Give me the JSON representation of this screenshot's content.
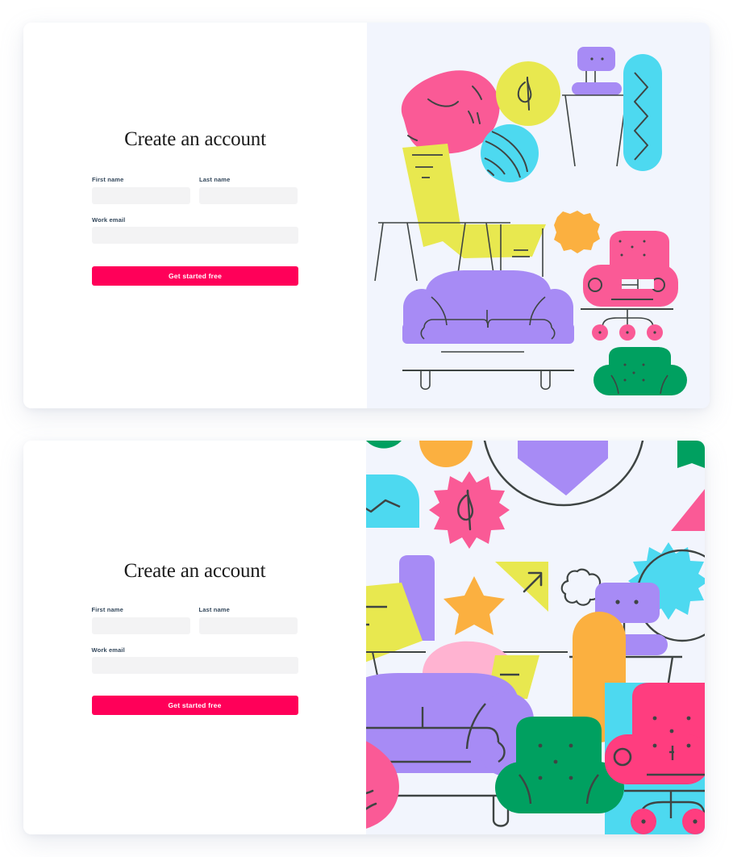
{
  "panels": [
    {
      "heading": "Create an account",
      "fields": {
        "first_name": {
          "label": "First name",
          "value": "",
          "placeholder": ""
        },
        "last_name": {
          "label": "Last name",
          "value": "",
          "placeholder": ""
        },
        "work_email": {
          "label": "Work email",
          "value": "",
          "placeholder": ""
        }
      },
      "cta_label": "Get started free"
    },
    {
      "heading": "Create an account",
      "fields": {
        "first_name": {
          "label": "First name",
          "value": "",
          "placeholder": ""
        },
        "last_name": {
          "label": "Last name",
          "value": "",
          "placeholder": ""
        },
        "work_email": {
          "label": "Work email",
          "value": "",
          "placeholder": ""
        }
      },
      "cta_label": "Get started free"
    }
  ],
  "colors": {
    "page_background": "#ffffff",
    "card_background": "#ffffff",
    "art_background": "#F2F5FD",
    "input_background": "#F3F3F4",
    "label_text": "#33475b",
    "heading_text": "#1b1b1b",
    "cta_background": "#FF0059",
    "cta_text": "#ffffff",
    "illustration_pink": "#FA5A96",
    "illustration_magenta": "#FF3D7F",
    "illustration_yellow": "#E8E84F",
    "illustration_cyan": "#4DD9F0",
    "illustration_purple": "#A78BF5",
    "illustration_orange": "#FBB040",
    "illustration_green": "#00A060",
    "illustration_lightpink": "#FFB3D1",
    "illustration_stroke": "#3E4443"
  },
  "illustration": {
    "panel_1_items": [
      "pink-blob",
      "yellow-circle-phi",
      "purple-stool-chair",
      "cyan-zigzag-pill",
      "yellow-lounge-chair",
      "cyan-beach-ball",
      "orange-burst",
      "purple-sofa",
      "pink-office-chair",
      "green-armchair"
    ],
    "panel_2_items": [
      "green-half-circle",
      "orange-half-circle",
      "purple-diamond",
      "circle-outline",
      "green-flag",
      "cyan-rounded-square-chart",
      "pink-starburst-phi",
      "pink-triangle",
      "purple-tab",
      "yellow-lounge-chair",
      "orange-star",
      "yellow-arrow-triangle",
      "cloud-outline",
      "purple-stool-chair",
      "cyan-starburst",
      "circle-outline-2",
      "pink-blob",
      "purple-sofa",
      "pink-round-blob",
      "orange-pill",
      "green-armchair",
      "pink-office-chair",
      "cyan-panel"
    ]
  }
}
